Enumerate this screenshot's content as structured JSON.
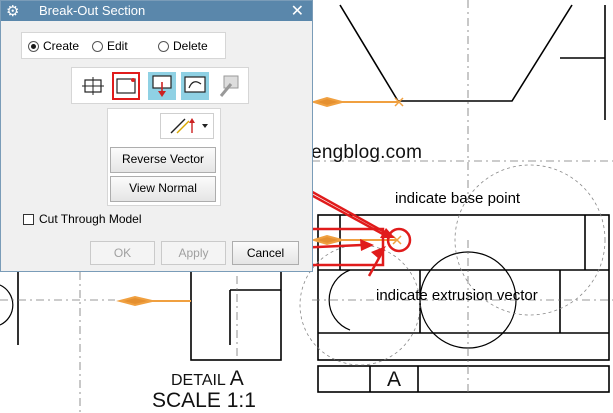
{
  "dialog": {
    "title": "Break-Out Section",
    "icons": {
      "title_icon": "gear-icon",
      "close_icon": "close-icon"
    },
    "mode_options": [
      {
        "label": "Create",
        "selected": true
      },
      {
        "label": "Edit",
        "selected": false
      },
      {
        "label": "Delete",
        "selected": false
      }
    ],
    "tools": [
      {
        "icon": "select-view-icon",
        "active": false,
        "selected": false
      },
      {
        "icon": "specify-base-point-icon",
        "active": false,
        "selected": true
      },
      {
        "icon": "specify-extrusion-vector-icon",
        "active": true,
        "selected": false
      },
      {
        "icon": "select-curve-icon",
        "active": true,
        "selected": false
      },
      {
        "icon": "modify-boundary-icon",
        "active": false,
        "selected": false
      }
    ],
    "vector_dropdown_icon": "vector-inferred-icon",
    "reverse_vector_label": "Reverse Vector",
    "view_normal_label": "View Normal",
    "cut_through_label": "Cut Through Model",
    "cut_through_checked": false,
    "ok_label": "OK",
    "apply_label": "Apply",
    "cancel_label": "Cancel"
  },
  "annotations": {
    "watermark": "mechanicalengblog.com",
    "base_point": "indicate base point",
    "extrusion_vector": "indicate extrusion vector"
  },
  "drawing": {
    "detail_prefix": "DETAIL",
    "detail_letter": "A",
    "scale": "SCALE 1:1",
    "section_letter": "A"
  },
  "colors": {
    "title_bar": "#5a87ab",
    "highlight_red": "#e01b1b",
    "vector_orange": "#f0a040",
    "tool_active": "#8fd1e4"
  }
}
